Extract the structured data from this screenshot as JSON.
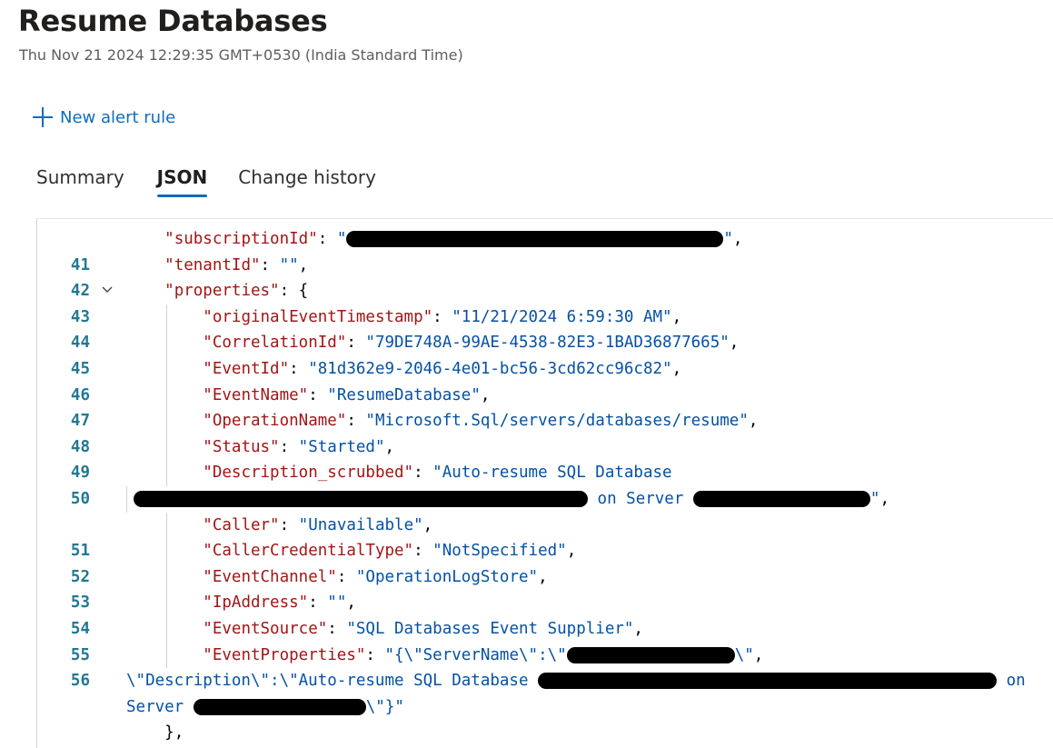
{
  "header": {
    "title": "Resume Databases",
    "timestamp": "Thu Nov 21 2024 12:29:35 GMT+0530 (India Standard Time)"
  },
  "toolbar": {
    "new_alert_rule_label": "New alert rule",
    "new_alert_rule_icon": "plus-icon"
  },
  "tabs": [
    {
      "label": "Summary",
      "active": false
    },
    {
      "label": "JSON",
      "active": true
    },
    {
      "label": "Change history",
      "active": false
    }
  ],
  "colors": {
    "accent": "#0f6cbd",
    "json_key": "#a31515",
    "json_string": "#0451a5",
    "line_number": "#237893"
  },
  "code": {
    "lines": [
      {
        "n": "41",
        "key": "\"subscriptionId\"",
        "value_prefix": "\"",
        "value_suffix": "\"",
        "tail": ","
      },
      {
        "n": "42",
        "key": "\"tenantId\"",
        "value": "\"\"",
        "tail": ","
      },
      {
        "n": "43",
        "key": "\"properties\"",
        "open": "{"
      },
      {
        "n": "44",
        "key": "\"originalEventTimestamp\"",
        "value": "\"11/21/2024 6:59:30 AM\"",
        "tail": ","
      },
      {
        "n": "45",
        "key": "\"CorrelationId\"",
        "value": "\"79DE748A-99AE-4538-82E3-1BAD36877665\"",
        "tail": ","
      },
      {
        "n": "46",
        "key": "\"EventId\"",
        "value": "\"81d362e9-2046-4e01-bc56-3cd62cc96c82\"",
        "tail": ","
      },
      {
        "n": "47",
        "key": "\"EventName\"",
        "value": "\"ResumeDatabase\"",
        "tail": ","
      },
      {
        "n": "48",
        "key": "\"OperationName\"",
        "value": "\"Microsoft.Sql/servers/databases/resume\"",
        "tail": ","
      },
      {
        "n": "49",
        "key": "\"Status\"",
        "value": "\"Started\"",
        "tail": ","
      },
      {
        "n": "50",
        "key": "\"Description_scrubbed\"",
        "value": "\"Auto-resume SQL Database",
        "wrap_mid": "on Server",
        "wrap_end": "\"",
        "tail": ","
      },
      {
        "n": "51",
        "key": "\"Caller\"",
        "value": "\"Unavailable\"",
        "tail": ","
      },
      {
        "n": "52",
        "key": "\"CallerCredentialType\"",
        "value": "\"NotSpecified\"",
        "tail": ","
      },
      {
        "n": "53",
        "key": "\"EventChannel\"",
        "value": "\"OperationLogStore\"",
        "tail": ","
      },
      {
        "n": "54",
        "key": "\"IpAddress\"",
        "value": "\"\"",
        "tail": ","
      },
      {
        "n": "55",
        "key": "\"EventSource\"",
        "value": "\"SQL Databases Event Supplier\"",
        "tail": ","
      },
      {
        "n": "56",
        "key": "\"EventProperties\"",
        "value": "\"{\\\"ServerName\\\":\\\"",
        "value_end": "\\\"",
        "tail": ",",
        "wrap1": "\\\"Description\\\":\\\"Auto-resume SQL Database",
        "wrap1_end": "on",
        "wrap2": "Server",
        "wrap2_end": "\\\"}\""
      },
      {
        "n": "57",
        "close": "},"
      }
    ]
  }
}
